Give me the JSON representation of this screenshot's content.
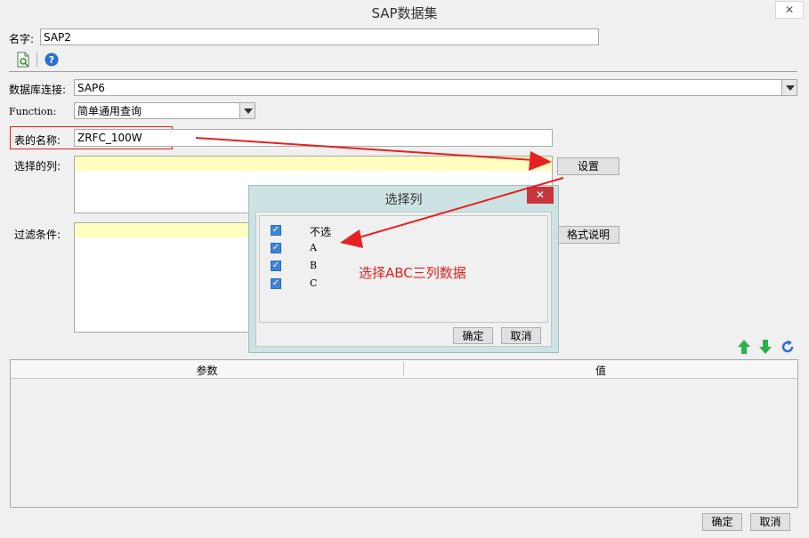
{
  "window": {
    "title": "SAP数据集",
    "close_label": "✕"
  },
  "form": {
    "name_label": "名字:",
    "name_value": "SAP2",
    "db_label": "数据库连接:",
    "db_value": "SAP6",
    "function_label": "Function:",
    "function_value": "简单通用查询",
    "table_label": "表的名称:",
    "table_value": "ZRFC_100W",
    "columns_label": "选择的列:",
    "settings_button": "设置",
    "filter_label": "过滤条件:",
    "format_button": "格式说明"
  },
  "grid": {
    "col_param": "参数",
    "col_value": "值"
  },
  "footer": {
    "ok": "确定",
    "cancel": "取消"
  },
  "dialog": {
    "title": "选择列",
    "close_label": "✕",
    "items": [
      {
        "label": "不选",
        "checked": true
      },
      {
        "label": "A",
        "checked": true
      },
      {
        "label": "B",
        "checked": true
      },
      {
        "label": "C",
        "checked": true
      }
    ],
    "ok": "确定",
    "cancel": "取消"
  },
  "annotation": {
    "text": "选择ABC三列数据",
    "color": "#e02020"
  },
  "icons": [
    "preview-icon",
    "help-icon",
    "move-up-icon",
    "move-down-icon",
    "refresh-icon"
  ]
}
